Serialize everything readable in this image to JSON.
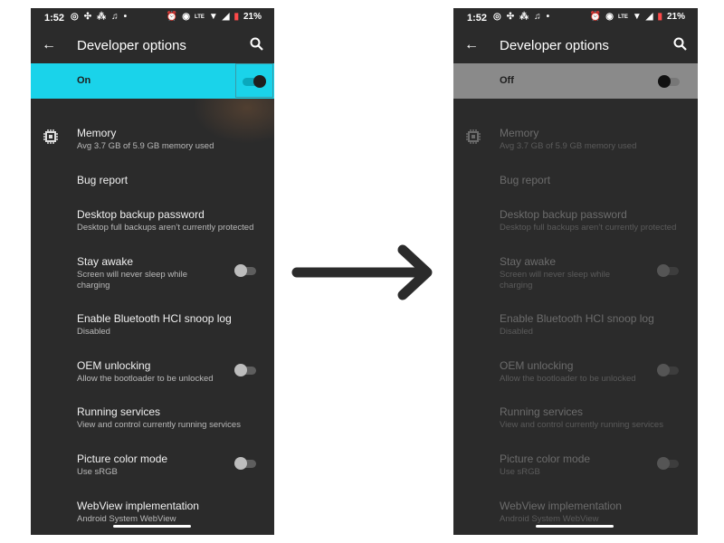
{
  "status_bar": {
    "time": "1:52",
    "left_icons": [
      "instagram-icon",
      "app-icon",
      "signal-dots-icon",
      "bell-icon",
      "dot-icon"
    ],
    "right_icons": [
      "alarm-icon",
      "eye-icon",
      "volte-icon",
      "wifi-icon",
      "cell-signal-icon"
    ],
    "battery": "21%"
  },
  "toolbar": {
    "title": "Developer options",
    "back_icon": "arrow-left-icon",
    "search_icon": "search-icon"
  },
  "before": {
    "master_label": "On",
    "master_bg": "#1ad3ea",
    "master_state": "on"
  },
  "after": {
    "master_label": "Off",
    "master_bg": "#8a8a8a",
    "master_state": "off"
  },
  "items": [
    {
      "title": "Memory",
      "subtitle": "Avg 3.7 GB of 5.9 GB memory used",
      "icon": "memory-chip-icon"
    },
    {
      "title": "Bug report",
      "subtitle": ""
    },
    {
      "title": "Desktop backup password",
      "subtitle": "Desktop full backups aren’t currently protected"
    },
    {
      "title": "Stay awake",
      "subtitle": "Screen will never sleep while charging",
      "toggle": "off"
    },
    {
      "title": "Enable Bluetooth HCI snoop log",
      "subtitle": "Disabled"
    },
    {
      "title": "OEM unlocking",
      "subtitle": "Allow the bootloader to be unlocked",
      "toggle": "off"
    },
    {
      "title": "Running services",
      "subtitle": "View and control currently running services"
    },
    {
      "title": "Picture color mode",
      "subtitle": "Use sRGB",
      "toggle": "off"
    },
    {
      "title": "WebView implementation",
      "subtitle": "Android System WebView"
    }
  ],
  "transition_arrow": "arrow-right-icon"
}
